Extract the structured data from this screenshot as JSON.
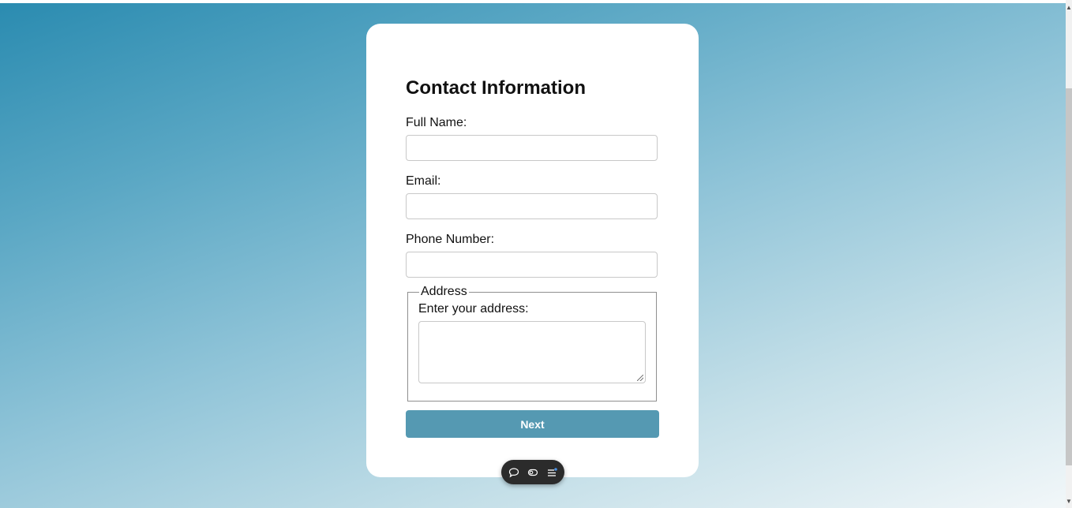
{
  "form": {
    "title": "Contact Information",
    "full_name_label": "Full Name:",
    "full_name_value": "",
    "email_label": "Email:",
    "email_value": "",
    "phone_label": "Phone Number:",
    "phone_value": "",
    "address_legend": "Address",
    "address_label": "Enter your address:",
    "address_value": "",
    "next_label": "Next"
  },
  "toolbar": {
    "icons": [
      "chat-bubble-icon",
      "toggle-icon",
      "menu-list-icon"
    ]
  },
  "colors": {
    "button": "#5599b2",
    "gradient_start": "#2a8bb0",
    "gradient_end": "#f2f7f9",
    "toolbar_bg": "#2b2b2b"
  }
}
